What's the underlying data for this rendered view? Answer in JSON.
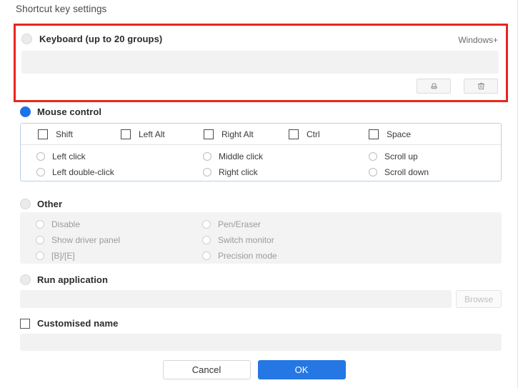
{
  "page": {
    "title": "Shortcut key settings",
    "accent_color": "#2577e3",
    "highlight_color": "#e8251f",
    "panel_border_color": "#b9cfe8"
  },
  "keyboard": {
    "label": "Keyboard (up to 20 groups)",
    "hint": "Windows+",
    "selected": false,
    "input_value": "",
    "buttons": [
      {
        "name": "clear-button",
        "icon": "brush-icon"
      },
      {
        "name": "delete-button",
        "icon": "trash-icon"
      }
    ]
  },
  "mouse_control": {
    "label": "Mouse control",
    "selected": true,
    "modifiers": [
      {
        "label": "Shift",
        "checked": false
      },
      {
        "label": "Left Alt",
        "checked": false
      },
      {
        "label": "Right Alt",
        "checked": false
      },
      {
        "label": "Ctrl",
        "checked": false
      },
      {
        "label": "Space",
        "checked": false
      }
    ],
    "actions": [
      {
        "label": "Left click",
        "selected": false
      },
      {
        "label": "Left double-click",
        "selected": false
      },
      {
        "label": "Middle click",
        "selected": false
      },
      {
        "label": "Right click",
        "selected": false
      },
      {
        "label": "Scroll up",
        "selected": false
      },
      {
        "label": "Scroll down",
        "selected": false
      }
    ]
  },
  "other": {
    "label": "Other",
    "selected": false,
    "disabled": true,
    "options": [
      {
        "label": "Disable",
        "selected": false
      },
      {
        "label": "Show driver panel",
        "selected": false
      },
      {
        "label": "[B]/[E]",
        "selected": false
      },
      {
        "label": "Pen/Eraser",
        "selected": false
      },
      {
        "label": "Switch monitor",
        "selected": false
      },
      {
        "label": "Precision mode",
        "selected": false
      }
    ]
  },
  "run_application": {
    "label": "Run application",
    "selected": false,
    "path_value": "",
    "browse_label": "Browse",
    "browse_disabled": true
  },
  "customised_name": {
    "label": "Customised name",
    "checked": false,
    "value": ""
  },
  "footer": {
    "cancel_label": "Cancel",
    "ok_label": "OK"
  }
}
